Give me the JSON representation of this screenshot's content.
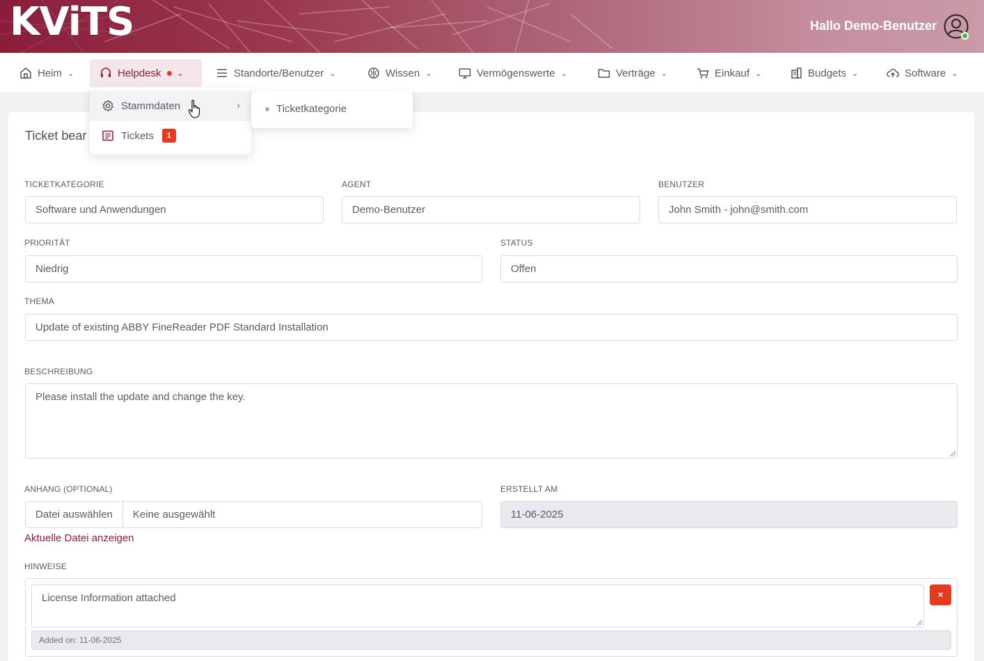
{
  "header": {
    "logo": "KViTS",
    "greeting": "Hallo Demo-Benutzer",
    "avatar_icon": "user-circle-icon",
    "status_color": "#3fbf3f"
  },
  "nav": {
    "items": [
      {
        "label": "Heim",
        "icon": "home-icon"
      },
      {
        "label": "Helpdesk",
        "icon": "headset-icon",
        "active": true
      },
      {
        "label": "Standorte/Benutzer",
        "icon": "menu-icon"
      },
      {
        "label": "Wissen",
        "icon": "brain-icon"
      },
      {
        "label": "Vermögenswerte",
        "icon": "monitor-icon"
      },
      {
        "label": "Verträge",
        "icon": "folder-icon"
      },
      {
        "label": "Einkauf",
        "icon": "cart-icon"
      },
      {
        "label": "Budgets",
        "icon": "building-icon"
      },
      {
        "label": "Software",
        "icon": "cloud-upload-icon"
      }
    ]
  },
  "dropdown": {
    "items": [
      {
        "label": "Stammdaten",
        "icon": "gear-icon"
      },
      {
        "label": "Tickets",
        "icon": "list-icon",
        "badge": "1"
      }
    ],
    "submenu": {
      "label": "Ticketkategorie"
    }
  },
  "card": {
    "title": "Ticket bear"
  },
  "form": {
    "ticketkategorie": {
      "label": "TICKETKATEGORIE",
      "value": "Software und Anwendungen"
    },
    "agent": {
      "label": "AGENT",
      "value": "Demo-Benutzer"
    },
    "benutzer": {
      "label": "BENUTZER",
      "value": "John Smith - john@smith.com"
    },
    "prioritaet": {
      "label": "PRIORITÄT",
      "value": "Niedrig"
    },
    "status": {
      "label": "STATUS",
      "value": "Offen"
    },
    "thema": {
      "label": "THEMA",
      "value": "Update of existing ABBY FineReader PDF Standard Installation"
    },
    "beschreibung": {
      "label": "BESCHREIBUNG",
      "value": "Please install the update and change the key."
    },
    "anhang": {
      "label": "ANHANG (OPTIONAL)",
      "button": "Datei auswählen",
      "filename": "Keine ausgewählt",
      "link": "Aktuelle Datei anzeigen"
    },
    "erstellt": {
      "label": "ERSTELLT AM",
      "value": "11-06-2025"
    },
    "hinweise": {
      "label": "HINWEISE",
      "note": "License Information attached",
      "added": "Added on: 11-06-2025",
      "remove": "×"
    }
  },
  "colors": {
    "accent": "#8a1e3a",
    "danger": "#e53a1e"
  }
}
